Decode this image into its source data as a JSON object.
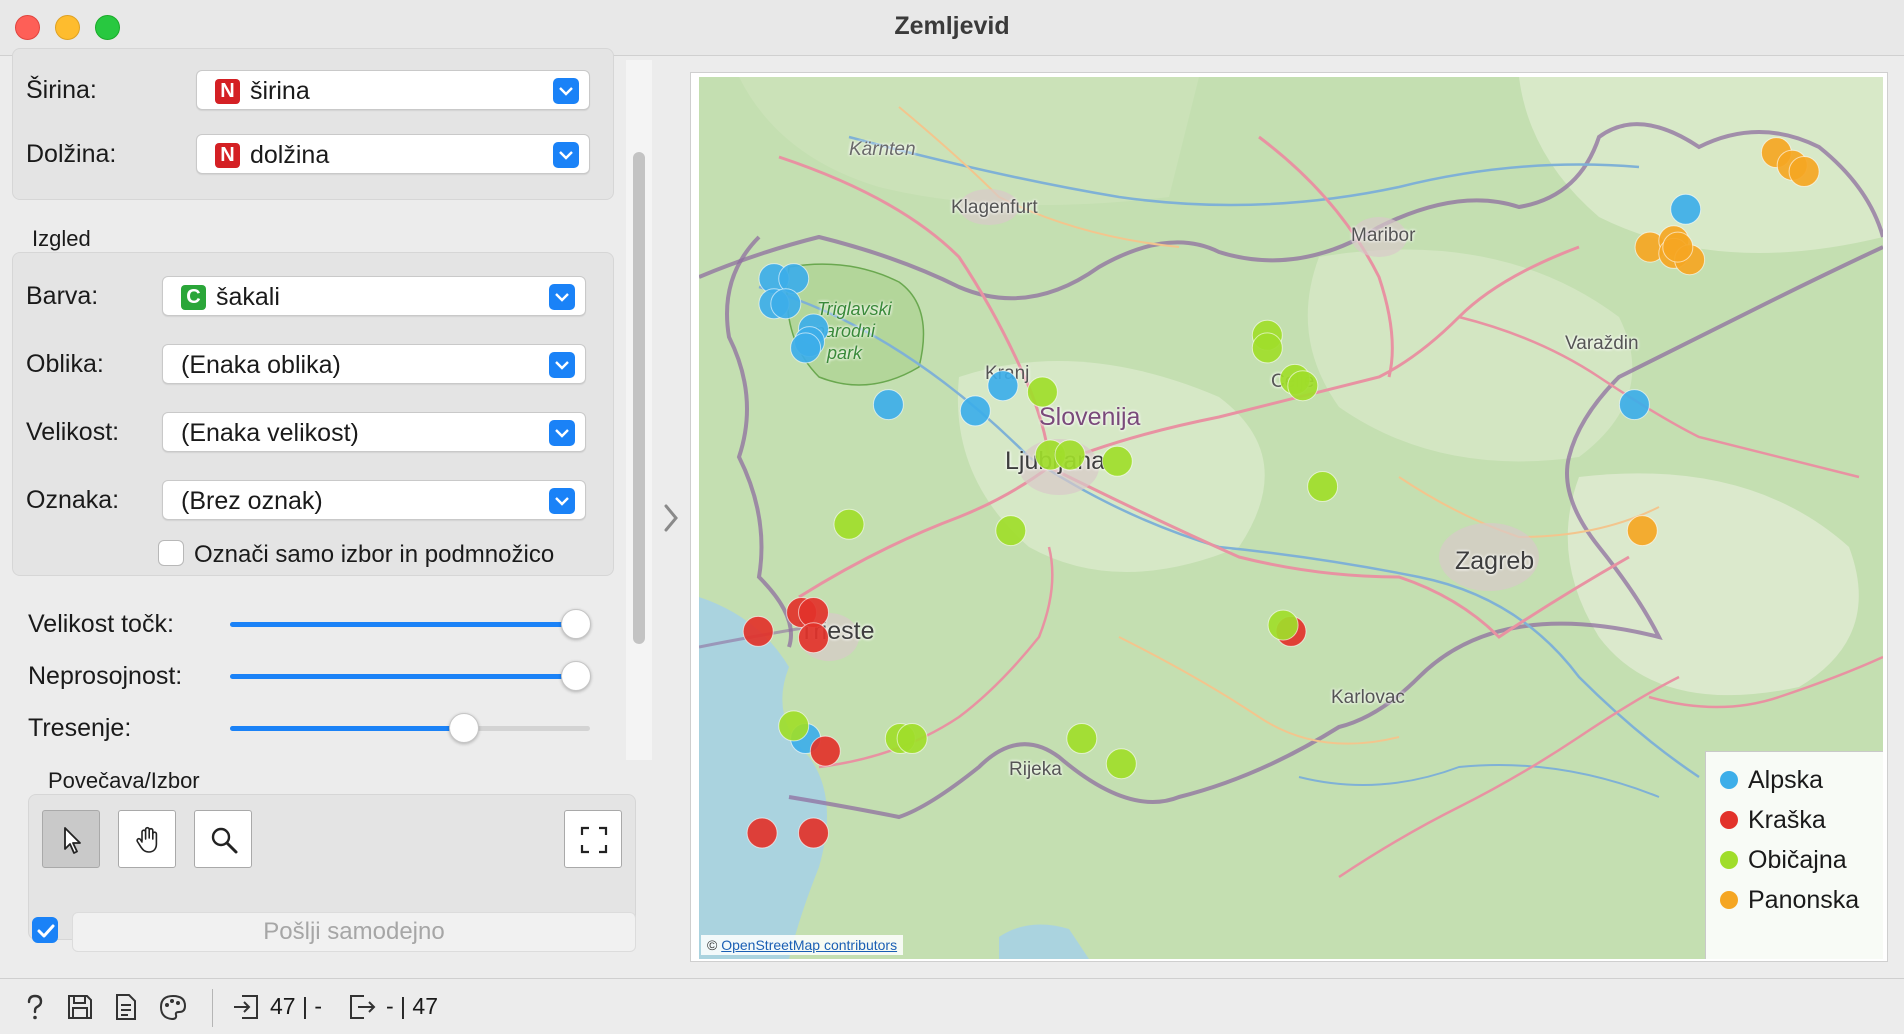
{
  "window": {
    "title": "Zemljevid"
  },
  "location": {
    "latitude_label": "Širina:",
    "latitude_value": "širina",
    "latitude_badge": "N",
    "longitude_label": "Dolžina:",
    "longitude_value": "dolžina",
    "longitude_badge": "N"
  },
  "appearance": {
    "section_title": "Izgled",
    "color_label": "Barva:",
    "color_value": "šakali",
    "color_badge": "C",
    "shape_label": "Oblika:",
    "shape_value": "(Enaka oblika)",
    "size_label": "Velikost:",
    "size_value": "(Enaka velikost)",
    "label_label": "Oznaka:",
    "label_value": "(Brez oznak)",
    "label_only_selection": "Označi samo izbor in podmnožico",
    "label_only_selection_checked": false
  },
  "sliders": {
    "point_size_label": "Velikost točk:",
    "point_size_value": 0.96,
    "opacity_label": "Neprosojnost:",
    "opacity_value": 0.96,
    "jitter_label": "Tresenje:",
    "jitter_value": 0.65
  },
  "zoom": {
    "section_title": "Povečava/Izbor",
    "tools": [
      "select-tool",
      "pan-tool",
      "zoom-tool"
    ],
    "active_tool": "select-tool"
  },
  "send": {
    "auto_checked": true,
    "label": "Pošlji samodejno"
  },
  "map": {
    "places": {
      "karnten": "Kärnten",
      "klagenfurt": "Klagenfurt",
      "maribor": "Maribor",
      "varazdin": "Varaždin",
      "kranj": "Kranj",
      "slovenija": "Slovenija",
      "ljubljana": "Ljubljana",
      "celje": "Celje",
      "zagreb": "Zagreb",
      "trieste": "Trieste",
      "karlovac": "Karlovac",
      "rijeka": "Rijeka",
      "park1": "Triglavski",
      "park2": "narodni",
      "park3": "park"
    },
    "attribution_prefix": "©",
    "attribution_link": "OpenStreetMap contributors",
    "colors": {
      "Alpska": "#3daee9",
      "Kraška": "#e2322a",
      "Običajna": "#a0dd2a",
      "Panonska": "#f5a623"
    }
  },
  "legend": {
    "items": [
      {
        "label": "Alpska",
        "color": "#3daee9"
      },
      {
        "label": "Kraška",
        "color": "#e2322a"
      },
      {
        "label": "Običajna",
        "color": "#a0dd2a"
      },
      {
        "label": "Panonska",
        "color": "#f5a623"
      }
    ]
  },
  "chart_data": {
    "type": "scatter",
    "title": "",
    "points": [
      {
        "series": "Alpska",
        "x": 13.74,
        "y": 46.43
      },
      {
        "series": "Alpska",
        "x": 13.79,
        "y": 46.43
      },
      {
        "series": "Alpska",
        "x": 13.74,
        "y": 46.39
      },
      {
        "series": "Alpska",
        "x": 13.77,
        "y": 46.39
      },
      {
        "series": "Alpska",
        "x": 13.84,
        "y": 46.35
      },
      {
        "series": "Alpska",
        "x": 13.83,
        "y": 46.33
      },
      {
        "series": "Alpska",
        "x": 13.82,
        "y": 46.32
      },
      {
        "series": "Alpska",
        "x": 14.03,
        "y": 46.23
      },
      {
        "series": "Alpska",
        "x": 14.32,
        "y": 46.26
      },
      {
        "series": "Alpska",
        "x": 14.25,
        "y": 46.22
      },
      {
        "series": "Alpska",
        "x": 13.82,
        "y": 45.7
      },
      {
        "series": "Alpska",
        "x": 15.92,
        "y": 46.23
      },
      {
        "series": "Alpska",
        "x": 16.05,
        "y": 46.54
      },
      {
        "series": "Kraška",
        "x": 13.7,
        "y": 45.87
      },
      {
        "series": "Kraška",
        "x": 13.81,
        "y": 45.9
      },
      {
        "series": "Kraška",
        "x": 13.84,
        "y": 45.9
      },
      {
        "series": "Kraška",
        "x": 13.84,
        "y": 45.86
      },
      {
        "series": "Kraška",
        "x": 13.87,
        "y": 45.68
      },
      {
        "series": "Kraška",
        "x": 13.71,
        "y": 45.55
      },
      {
        "series": "Kraška",
        "x": 13.84,
        "y": 45.55
      },
      {
        "series": "Kraška",
        "x": 15.05,
        "y": 45.87
      },
      {
        "series": "Običajna",
        "x": 13.93,
        "y": 46.04
      },
      {
        "series": "Običajna",
        "x": 14.42,
        "y": 46.25
      },
      {
        "series": "Običajna",
        "x": 14.44,
        "y": 46.15
      },
      {
        "series": "Običajna",
        "x": 14.49,
        "y": 46.15
      },
      {
        "series": "Običajna",
        "x": 14.61,
        "y": 46.14
      },
      {
        "series": "Običajna",
        "x": 14.34,
        "y": 46.03
      },
      {
        "series": "Običajna",
        "x": 14.99,
        "y": 46.34
      },
      {
        "series": "Običajna",
        "x": 14.99,
        "y": 46.32
      },
      {
        "series": "Običajna",
        "x": 15.06,
        "y": 46.27
      },
      {
        "series": "Običajna",
        "x": 15.08,
        "y": 46.26
      },
      {
        "series": "Običajna",
        "x": 15.13,
        "y": 46.1
      },
      {
        "series": "Običajna",
        "x": 15.03,
        "y": 45.88
      },
      {
        "series": "Običajna",
        "x": 13.79,
        "y": 45.72
      },
      {
        "series": "Običajna",
        "x": 14.06,
        "y": 45.7
      },
      {
        "series": "Običajna",
        "x": 14.09,
        "y": 45.7
      },
      {
        "series": "Običajna",
        "x": 14.52,
        "y": 45.7
      },
      {
        "series": "Običajna",
        "x": 14.62,
        "y": 45.66
      },
      {
        "series": "Panonska",
        "x": 16.28,
        "y": 46.63
      },
      {
        "series": "Panonska",
        "x": 16.32,
        "y": 46.61
      },
      {
        "series": "Panonska",
        "x": 16.35,
        "y": 46.6
      },
      {
        "series": "Panonska",
        "x": 15.96,
        "y": 46.48
      },
      {
        "series": "Panonska",
        "x": 16.02,
        "y": 46.49
      },
      {
        "series": "Panonska",
        "x": 16.02,
        "y": 46.47
      },
      {
        "series": "Panonska",
        "x": 16.06,
        "y": 46.46
      },
      {
        "series": "Panonska",
        "x": 15.94,
        "y": 46.03
      },
      {
        "series": "Panonska",
        "x": 16.03,
        "y": 46.48
      }
    ],
    "xlabel": "",
    "ylabel": "",
    "xlim": [
      13.55,
      16.55
    ],
    "ylim": [
      45.35,
      46.75
    ]
  },
  "status": {
    "input_count": "47 | -",
    "output_count": "- | 47"
  }
}
